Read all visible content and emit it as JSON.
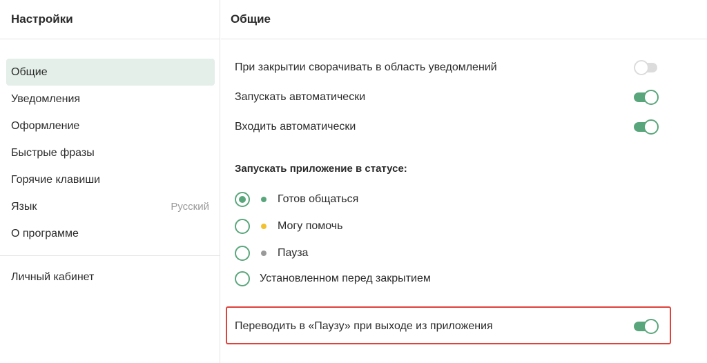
{
  "sidebar": {
    "title": "Настройки",
    "items": [
      {
        "label": "Общие",
        "value": ""
      },
      {
        "label": "Уведомления",
        "value": ""
      },
      {
        "label": "Оформление",
        "value": ""
      },
      {
        "label": "Быстрые фразы",
        "value": ""
      },
      {
        "label": "Горячие клавиши",
        "value": ""
      },
      {
        "label": "Язык",
        "value": "Русский"
      },
      {
        "label": "О программе",
        "value": ""
      }
    ],
    "extra_item": "Личный кабинет",
    "active_index": 0
  },
  "main": {
    "title": "Общие",
    "toggles": [
      {
        "label": "При закрытии сворачивать в область уведомлений",
        "on": false
      },
      {
        "label": "Запускать автоматически",
        "on": true
      },
      {
        "label": "Входить автоматически",
        "on": true
      }
    ],
    "status_section": {
      "title": "Запускать приложение в статусе:",
      "options": [
        {
          "label": "Готов общаться",
          "dot_color": "#5aa67c",
          "checked": true
        },
        {
          "label": "Могу помочь",
          "dot_color": "#f2c12e",
          "checked": false
        },
        {
          "label": "Пауза",
          "dot_color": "#9a9a9a",
          "checked": false
        },
        {
          "label": "Установленном перед закрытием",
          "dot_color": "",
          "checked": false
        }
      ]
    },
    "pause_on_exit": {
      "label": "Переводить в «Паузу» при выходе из приложения",
      "on": true
    }
  },
  "colors": {
    "accent": "#5aa67c",
    "active_nav_bg": "#e3efe8",
    "highlight": "#e0413a"
  }
}
